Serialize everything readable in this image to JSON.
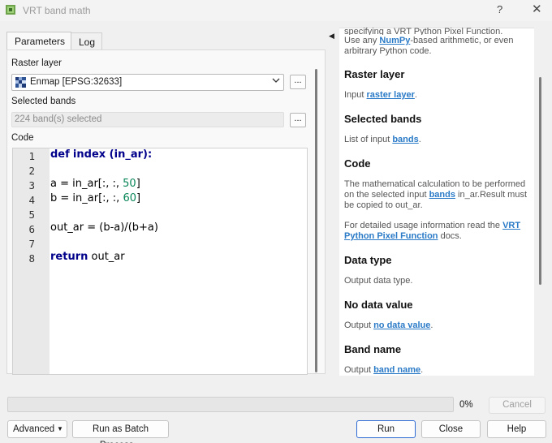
{
  "window": {
    "title": "VRT band math",
    "help_glyph": "?",
    "close_glyph": "✕"
  },
  "tabs": [
    {
      "label": "Parameters"
    },
    {
      "label": "Log"
    }
  ],
  "form": {
    "raster_layer_label": "Raster layer",
    "raster_layer_value": "Enmap [EPSG:32633]",
    "dots": "...",
    "selected_bands_label": "Selected bands",
    "selected_bands_value": "224 band(s) selected",
    "code_label": "Code"
  },
  "code": {
    "line_numbers": [
      "1",
      "2",
      "3",
      "4",
      "5",
      "6",
      "7",
      "8"
    ],
    "lines": [
      {
        "kw": "def",
        "kw2": "index",
        "rest": " (in_ar):"
      },
      {
        "text": ""
      },
      {
        "pre": "a = in_ar[:, :, ",
        "num": "50",
        "post": "]"
      },
      {
        "pre": "b = in_ar[:, :, ",
        "num": "60",
        "post": "]"
      },
      {
        "text": ""
      },
      {
        "text": "out_ar = (b-a)/(b+a)"
      },
      {
        "text": ""
      },
      {
        "kw": "return",
        "rest": " out_ar"
      }
    ]
  },
  "help": {
    "intro_partial": "specifying a VRT Python Pixel Function.",
    "intro_line2_pre": "Use any ",
    "intro_link": "NumPy",
    "intro_line2_post": "-based arithmetic, or even",
    "intro_line3": "arbitrary Python code.",
    "raster_head": "Raster layer",
    "raster_pre": "Input ",
    "raster_link": "raster layer",
    "raster_post": ".",
    "bands_head": "Selected bands",
    "bands_pre": "List of input ",
    "bands_link": "bands",
    "bands_post": ".",
    "code_head": "Code",
    "code_l1": "The mathematical calculation to be performed",
    "code_l2_pre": "on the selected input ",
    "code_l2_link": "bands",
    "code_l2_post": " in_ar.Result must",
    "code_l3": "be copied to out_ar.",
    "code_l4_pre": "For detailed usage information read the ",
    "code_l4_link": "VRT",
    "code_l5_link": "Python Pixel Function",
    "code_l5_post": " docs.",
    "dtype_head": "Data type",
    "dtype_text": "Output data type.",
    "nodata_head": "No data value",
    "nodata_pre": "Output ",
    "nodata_link": "no data value",
    "nodata_post": ".",
    "bandname_head": "Band name",
    "bandname_pre": "Output ",
    "bandname_link": "band name",
    "bandname_post": "."
  },
  "progress": {
    "value_pct": 0,
    "label": "0%",
    "cancel_label": "Cancel"
  },
  "buttons": {
    "advanced": "Advanced",
    "batch": "Run as Batch Process...",
    "run": "Run",
    "close": "Close",
    "help": "Help"
  },
  "colors": {
    "link": "#2a7ac7",
    "keyword": "#00008b",
    "number": "#098658",
    "run_border": "#2d6ad4"
  }
}
